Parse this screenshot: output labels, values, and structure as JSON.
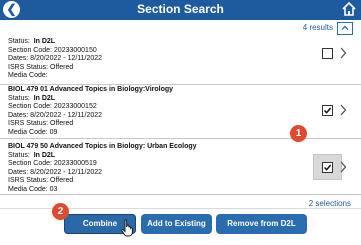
{
  "header": {
    "title": "Section Search"
  },
  "results": {
    "count_text": "4 results"
  },
  "cards": [
    {
      "heading": "",
      "status_label": "Status:",
      "status_value": "In D2L",
      "section_code": "Section Code: 20233000150",
      "dates": "Dates: 8/20/2022 - 12/11/2022",
      "isrs_status": "ISRS Status: Offered",
      "media_code": "Media Code:",
      "checked": false
    },
    {
      "heading": "BIOL 479 01 Advanced Topics in Biology:Virology",
      "status_label": "Status:",
      "status_value": "In D2L",
      "section_code": "Section Code: 20233000152",
      "dates": "Dates: 8/20/2022 - 12/11/2022",
      "isrs_status": "ISRS Status: Offered",
      "media_code": "Media Code: 09",
      "checked": true
    },
    {
      "heading": "BIOL 479 50 Advanced Topics in Biology: Urban Ecology",
      "status_label": "Status:",
      "status_value": "In D2L",
      "section_code": "Section Code: 20233000519",
      "dates": "Dates: 8/20/2022 - 12/11/2022",
      "isrs_status": "ISRS Status: Offered",
      "media_code": "Media Code: 03",
      "checked": true
    }
  ],
  "callouts": {
    "badge1": "1",
    "badge2": "2"
  },
  "footer": {
    "selections_text": "2 selections",
    "combine_label": "Combine",
    "add_label": "Add to Existing",
    "remove_label": "Remove from D2L"
  },
  "colors": {
    "header_bg": "#1e5a9e",
    "button_bg": "#2a6cb0",
    "callout_badge": "#e04b30"
  }
}
